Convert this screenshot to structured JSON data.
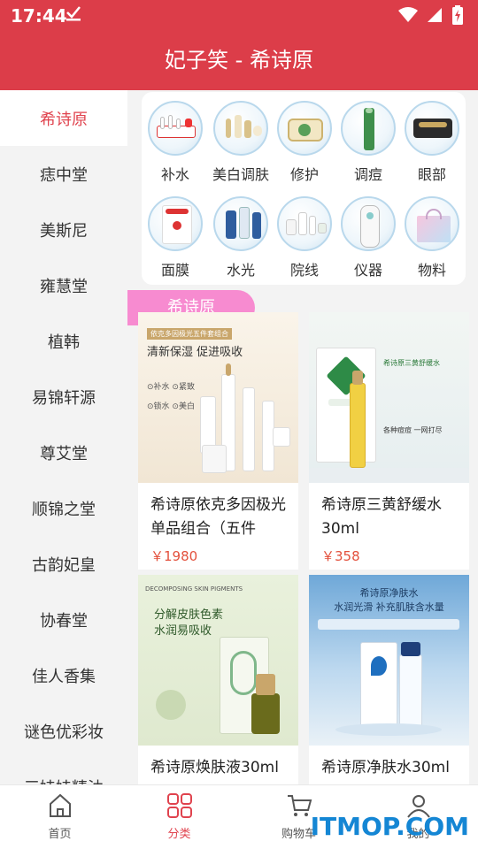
{
  "status": {
    "time": "17:44"
  },
  "header": {
    "title": "妃子笑 - 希诗原"
  },
  "sidebar": {
    "items": [
      {
        "label": "希诗原"
      },
      {
        "label": "痣中堂"
      },
      {
        "label": "美斯尼"
      },
      {
        "label": "雍慧堂"
      },
      {
        "label": "植韩"
      },
      {
        "label": "易锦轩源"
      },
      {
        "label": "尊艾堂"
      },
      {
        "label": "顺锦之堂"
      },
      {
        "label": "古韵妃皇"
      },
      {
        "label": "协春堂"
      },
      {
        "label": "佳人香集"
      },
      {
        "label": "谜色优彩妆"
      },
      {
        "label": "三娃娃精油"
      }
    ]
  },
  "categories": [
    {
      "label": "补水",
      "icon": "skincare-set-icon"
    },
    {
      "label": "美白调肤",
      "icon": "whitening-set-icon"
    },
    {
      "label": "修护",
      "icon": "repair-jar-icon"
    },
    {
      "label": "调痘",
      "icon": "acne-tube-icon"
    },
    {
      "label": "眼部",
      "icon": "eye-cream-icon"
    },
    {
      "label": "面膜",
      "icon": "face-mask-icon"
    },
    {
      "label": "水光",
      "icon": "hydra-vial-icon"
    },
    {
      "label": "院线",
      "icon": "salon-set-icon"
    },
    {
      "label": "仪器",
      "icon": "device-icon"
    },
    {
      "label": "物料",
      "icon": "gift-bag-icon"
    }
  ],
  "section": {
    "label": "希诗原"
  },
  "products": [
    {
      "name": "希诗原依克多因极光单品组合（五件",
      "price": "￥1980",
      "banner_line1": "依克多因极光五件套组合",
      "banner_line2": "清新保湿 促进吸收",
      "banner_tags": [
        "补水",
        "紧致",
        "锁水",
        "美白"
      ]
    },
    {
      "name": "希诗原三黄舒缓水30ml",
      "price": "￥358",
      "banner_line1": "希诗原三黄舒缓水",
      "banner_line2": "各种痘痘 一网打尽"
    },
    {
      "name": "希诗原焕肤液30ml",
      "price": "",
      "banner_line1": "分解皮肤色素",
      "banner_line2": "水润易吸收"
    },
    {
      "name": "希诗原净肤水30ml",
      "price": "",
      "banner_line1": "希诗原净肤水",
      "banner_line2": "水润光滑 补充肌肤含水量"
    }
  ],
  "bottomnav": {
    "items": [
      {
        "label": "首页",
        "icon": "home-icon"
      },
      {
        "label": "分类",
        "icon": "category-icon"
      },
      {
        "label": "购物车",
        "icon": "cart-icon"
      },
      {
        "label": "我的",
        "icon": "user-icon"
      }
    ]
  },
  "watermark": "ITMOP.COM",
  "colors": {
    "brand": "#dc3d49",
    "accent": "#e0434e",
    "tag": "#f78bd0",
    "price": "#e3503c"
  }
}
